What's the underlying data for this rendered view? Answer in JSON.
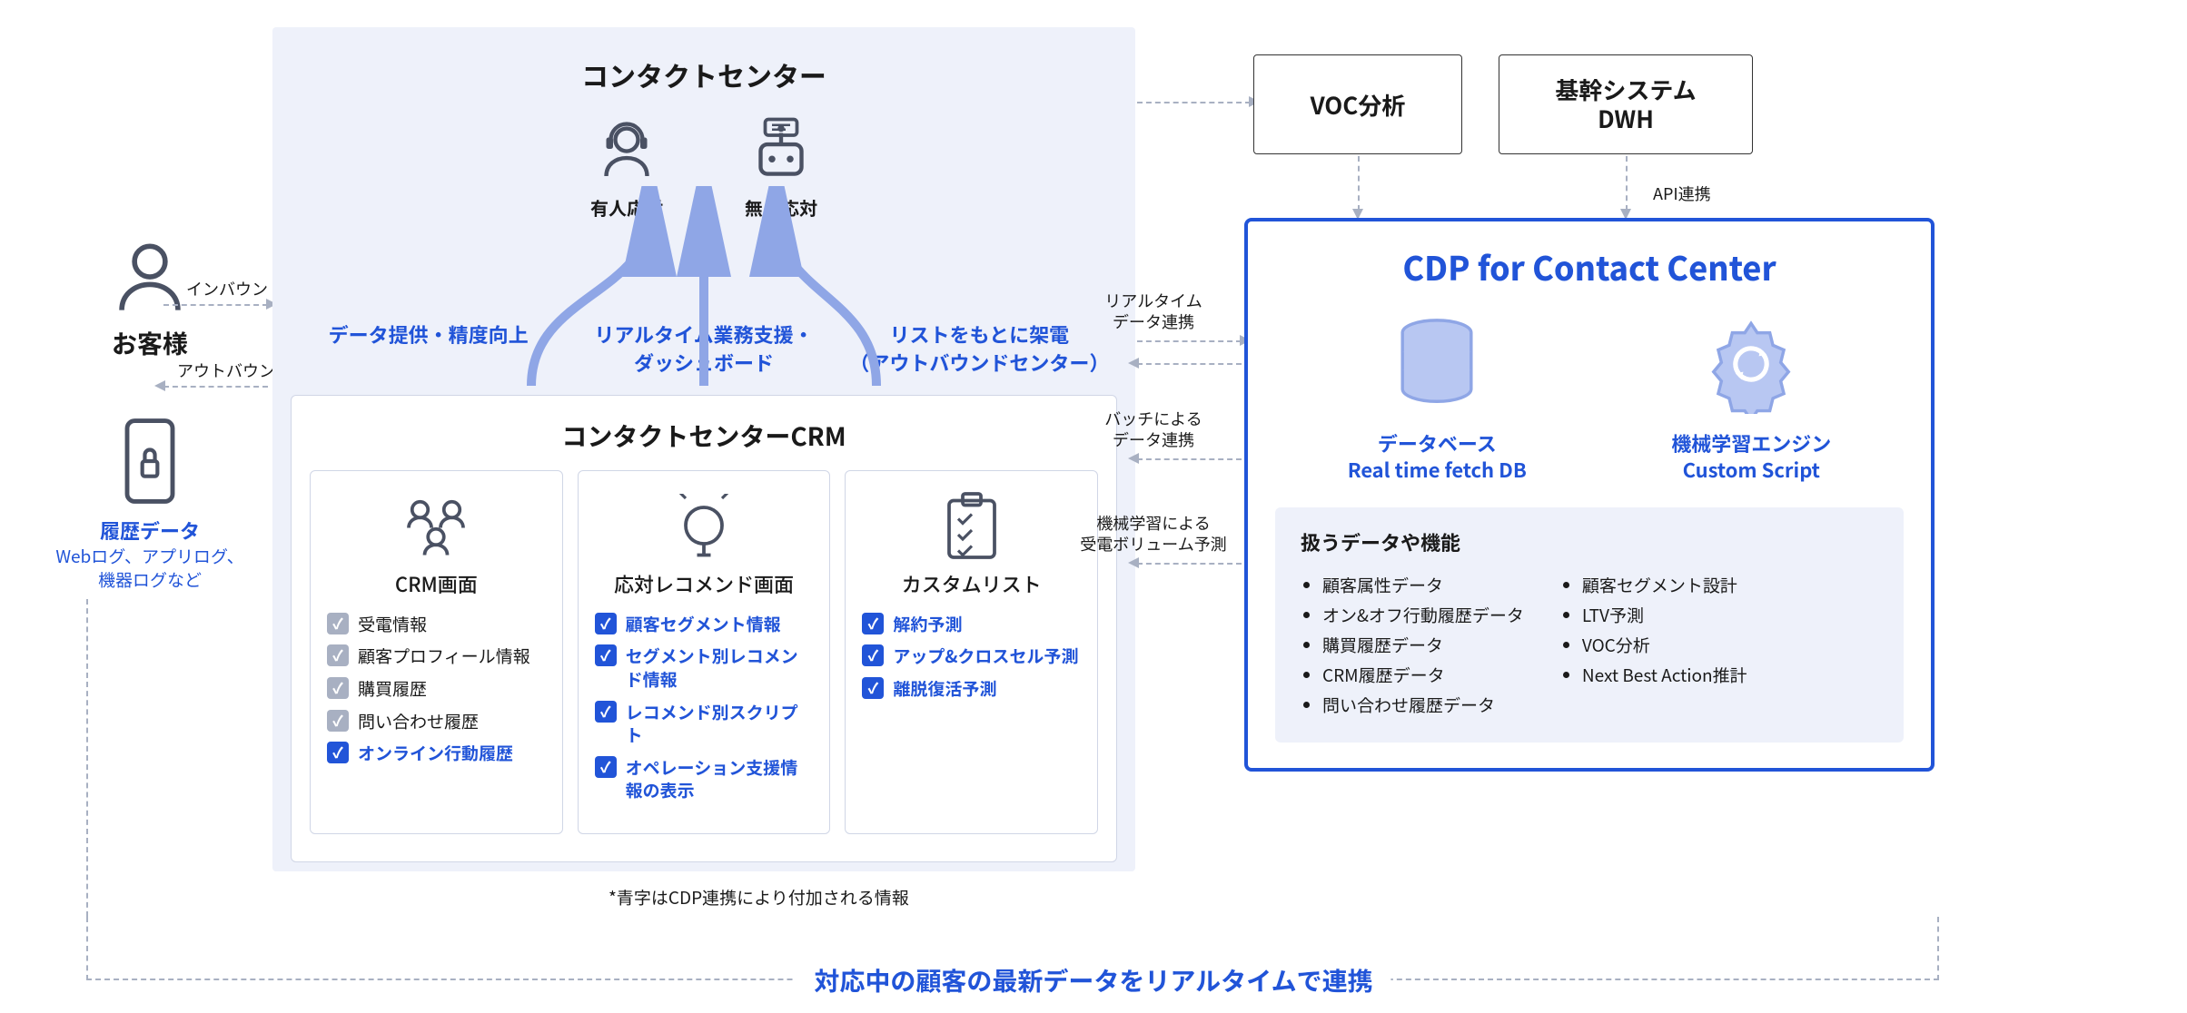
{
  "customer": {
    "label": "お客様",
    "history_title": "履歴データ",
    "history_desc": "Webログ、アプリログ、\n機器ログなど",
    "inbound": "インバウンド",
    "outbound": "アウトバウンド"
  },
  "contact_center": {
    "title": "コンタクトセンター",
    "human": "有人応対",
    "bot": "無人応対",
    "flow1": "データ提供・精度向上",
    "flow2_l1": "リアルタイム業務支援・",
    "flow2_l2": "ダッシュボード",
    "flow3_l1": "リストをもとに架電",
    "flow3_l2": "（アウトバウンドセンター）"
  },
  "crm": {
    "title": "コンタクトセンターCRM",
    "cols": [
      {
        "title": "CRM画面",
        "items": [
          {
            "label": "受電情報",
            "blue": false
          },
          {
            "label": "顧客プロフィール情報",
            "blue": false
          },
          {
            "label": "購買履歴",
            "blue": false
          },
          {
            "label": "問い合わせ履歴",
            "blue": false
          },
          {
            "label": "オンライン行動履歴",
            "blue": true
          }
        ]
      },
      {
        "title": "応対レコメンド画面",
        "items": [
          {
            "label": "顧客セグメント情報",
            "blue": true
          },
          {
            "label": "セグメント別レコメンド情報",
            "blue": true
          },
          {
            "label": "レコメンド別スクリプト",
            "blue": true
          },
          {
            "label": "オペレーション支援情報の表示",
            "blue": true
          }
        ]
      },
      {
        "title": "カスタムリスト",
        "items": [
          {
            "label": "解約予測",
            "blue": true
          },
          {
            "label": "アップ&クロスセル予測",
            "blue": true
          },
          {
            "label": "離脱復活予測",
            "blue": true
          }
        ]
      }
    ]
  },
  "footnote": "*青字はCDP連携により付加される情報",
  "mid_labels": {
    "realtime": "リアルタイム\nデータ連携",
    "batch": "バッチによる\nデータ連携",
    "ml": "機械学習による\n受電ボリューム予測"
  },
  "voc": "VOC分析",
  "dwh": "基幹システム\nDWH",
  "api_label": "API連携",
  "cdp": {
    "title": "CDP for Contact Center",
    "db_l1": "データベース",
    "db_l2": "Real time fetch DB",
    "ml_l1": "機械学習エンジン",
    "ml_l2": "Custom Script",
    "data_title": "扱うデータや機能",
    "left": [
      "顧客属性データ",
      "オン&オフ行動履歴データ",
      "購買履歴データ",
      "CRM履歴データ",
      "問い合わせ履歴データ"
    ],
    "right": [
      "顧客セグメント設計",
      "LTV予測",
      "VOC分析",
      "Next Best Action推計"
    ]
  },
  "bottom": "対応中の顧客の最新データをリアルタイムで連携"
}
